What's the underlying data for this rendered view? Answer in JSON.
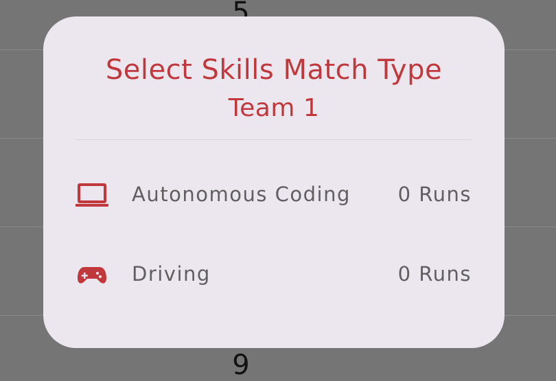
{
  "background": {
    "numbers": [
      "5",
      "9"
    ]
  },
  "dialog": {
    "title": "Select Skills Match Type",
    "subtitle": "Team 1",
    "options": [
      {
        "icon": "laptop-icon",
        "label": "Autonomous Coding",
        "count": "0 Runs"
      },
      {
        "icon": "gamepad-icon",
        "label": "Driving",
        "count": "0 Runs"
      }
    ]
  },
  "colors": {
    "accent": "#c1383c",
    "dialog_bg": "#ece7ef",
    "scrim": "#757575",
    "secondary_text": "#5f5f5f"
  }
}
